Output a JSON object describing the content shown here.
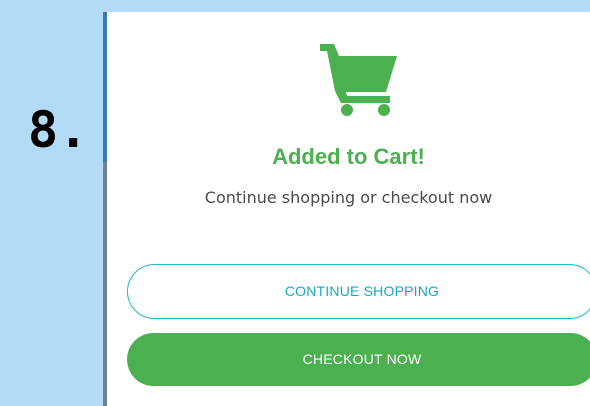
{
  "step_label": "8.",
  "dialog": {
    "icon": "shopping-cart-icon",
    "title": "Added to Cart!",
    "message": "Continue shopping or checkout now",
    "continue_label": "CONTINUE SHOPPING",
    "checkout_label": "CHECKOUT NOW"
  },
  "colors": {
    "background": "#b3daf7",
    "accent_green": "#4caf50",
    "outline_teal": "#22b8c6",
    "text_gray": "#4a4a4a"
  }
}
